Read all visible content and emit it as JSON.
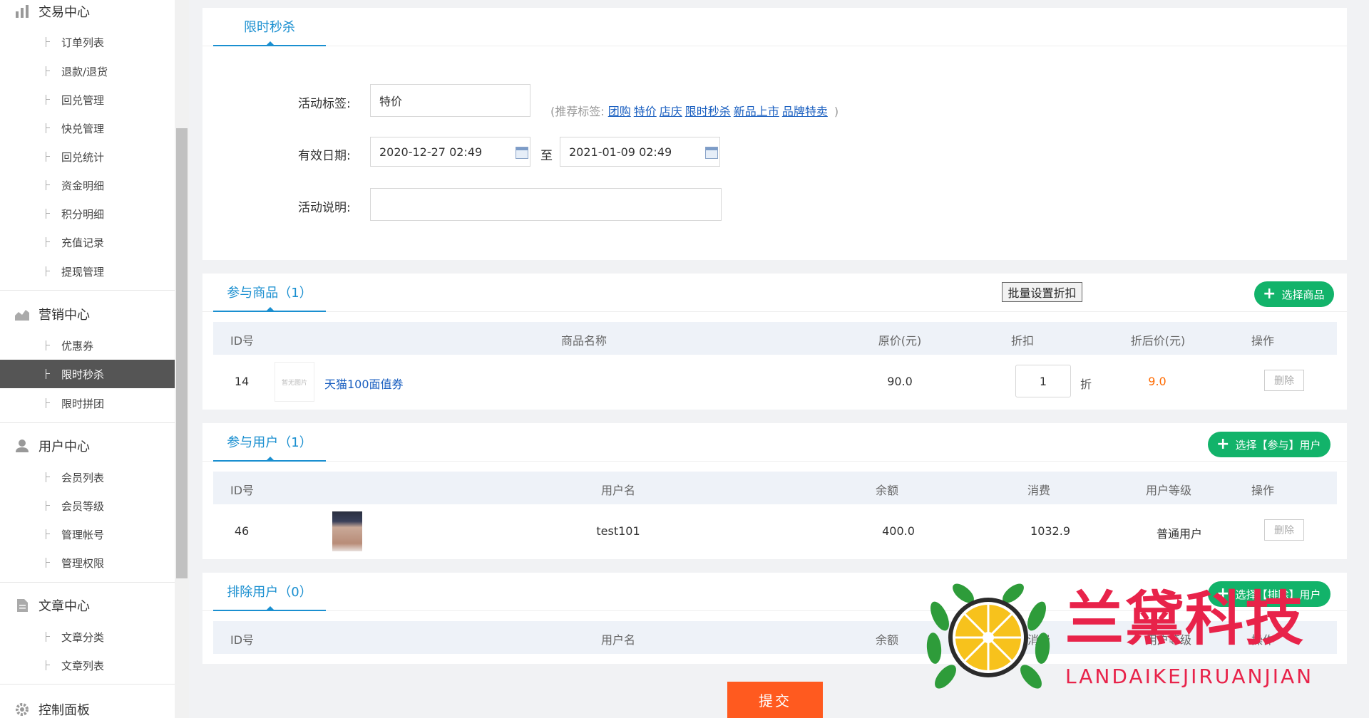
{
  "sidebar": {
    "sections": [
      {
        "label": "交易中心",
        "icon": "bar-chart-icon",
        "items": [
          "订单列表",
          "退款/退货",
          "回兑管理",
          "快兑管理",
          "回兑统计",
          "资金明细",
          "积分明细",
          "充值记录",
          "提现管理"
        ]
      },
      {
        "label": "营销中心",
        "icon": "area-chart-icon",
        "items": [
          "优惠券",
          "限时秒杀",
          "限时拼团"
        ],
        "active_item": "限时秒杀"
      },
      {
        "label": "用户中心",
        "icon": "user-icon",
        "items": [
          "会员列表",
          "会员等级",
          "管理帐号",
          "管理权限"
        ]
      },
      {
        "label": "文章中心",
        "icon": "document-icon",
        "items": [
          "文章分类",
          "文章列表"
        ]
      },
      {
        "label": "控制面板",
        "icon": "gear-icon",
        "items": []
      }
    ]
  },
  "form": {
    "tab": "限时秒杀",
    "tag_label": "活动标签:",
    "tag_value": "特价",
    "recommend_prefix": "(推荐标签:",
    "recommend_tags": [
      "团购",
      "特价",
      "店庆",
      "限时秒杀",
      "新品上市",
      "品牌特卖"
    ],
    "recommend_suffix": ")",
    "date_label": "有效日期:",
    "start_date": "2020-12-27 02:49",
    "date_sep": "至",
    "end_date": "2021-01-09 02:49",
    "desc_label": "活动说明:",
    "desc_value": ""
  },
  "products": {
    "tab": "参与商品（1）",
    "batch_button": "批量设置折扣",
    "select_button": "选择商品",
    "columns": [
      "ID号",
      "商品名称",
      "原价(元)",
      "折扣",
      "折后价(元)",
      "操作"
    ],
    "rows": [
      {
        "id": "14",
        "thumb_text": "暂无图片",
        "name": "天猫100面值券",
        "price": "90.0",
        "discount": "1",
        "discount_unit": "折",
        "final_price": "9.0",
        "action": "删除"
      }
    ]
  },
  "users": {
    "tab": "参与用户（1）",
    "select_button": "选择【参与】用户",
    "columns": [
      "ID号",
      "用户名",
      "余额",
      "消费",
      "用户等级",
      "操作"
    ],
    "rows": [
      {
        "id": "46",
        "username": "test101",
        "balance": "400.0",
        "spent": "1032.9",
        "level": "普通用户",
        "action": "删除"
      }
    ]
  },
  "excluded": {
    "tab": "排除用户（0）",
    "select_button": "选择【排除】用户",
    "columns": [
      "ID号",
      "用户名",
      "余额",
      "消费",
      "用户等级",
      "操作"
    ]
  },
  "submit_label": "提交",
  "watermark": {
    "name": "兰黛科技",
    "sub": "LANDAIKEJIRUANJIAN"
  },
  "colors": {
    "accent": "#1a8fd0",
    "green_button": "#12b36a",
    "submit": "#ff5a1f",
    "price_highlight": "#ff6a00",
    "active_menu": "#555555"
  }
}
